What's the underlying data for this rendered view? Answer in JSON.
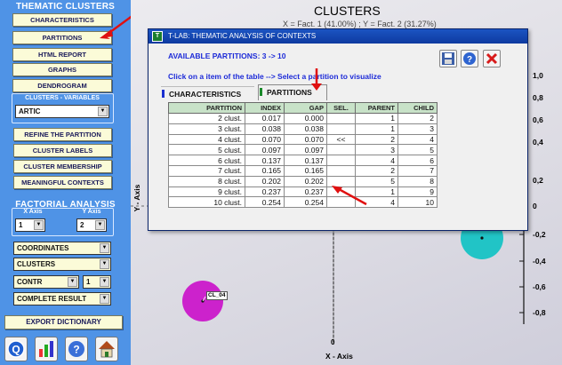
{
  "left_panel": {
    "thematic_clusters_title": "THEMATIC CLUSTERS",
    "buttons": [
      "CHARACTERISTICS",
      "PARTITIONS",
      "HTML REPORT",
      "GRAPHS",
      "DENDROGRAM"
    ],
    "clusters_variables_title": "CLUSTERS - VARIABLES",
    "variable_select": "ARTIC",
    "buttons2": [
      "REFINE THE PARTITION",
      "CLUSTER LABELS",
      "CLUSTER MEMBERSHIP",
      "MEANINGFUL CONTEXTS"
    ],
    "factorial_title": "FACTORIAL ANALYSIS",
    "x_axis_label": "X Axis",
    "y_axis_label": "Y Axis",
    "x_axis_value": "1",
    "y_axis_value": "2",
    "coordinates_select": "COORDINATES",
    "clusters_select": "CLUSTERS",
    "contr_select": "CONTR",
    "contr_num_select": "1",
    "complete_result_select": "COMPLETE RESULT",
    "export_button": "EXPORT DICTIONARY",
    "bottom_icons": [
      "q-logo-icon",
      "chart-icon",
      "help-icon",
      "home-icon"
    ]
  },
  "plot": {
    "title": "CLUSTERS",
    "subtitle": "X = Fact. 1 (41.00%) ; Y = Fact. 2 (31.27%)",
    "x_axis_title": "X - Axis",
    "y_axis_title": "Y - Axis",
    "y_ticks": [
      "1,0",
      "0,8",
      "0,6",
      "0,4",
      "0,2",
      "0",
      "-0,2",
      "-0,4",
      "-0,6",
      "-0,8"
    ],
    "x_zero_label": "0",
    "cluster_label": "CL_04",
    "cluster_colors": {
      "cl04": "#cc22cc",
      "teal": "#21c4c6"
    }
  },
  "dialog": {
    "title": "T-LAB: THEMATIC ANALYSIS OF CONTEXTS",
    "available": "AVAILABLE PARTITIONS: 3 -> 10",
    "instruction": "Click on a item of the table --> Select a partition to visualize",
    "tabs": [
      "CHARACTERISTICS",
      "PARTITIONS"
    ],
    "icons": [
      "save-icon",
      "help-icon",
      "close-icon"
    ],
    "table": {
      "headers": [
        "PARTITION",
        "INDEX",
        "GAP",
        "SEL.",
        "PARENT",
        "CHILD"
      ],
      "rows": [
        [
          "2 clust.",
          "0.017",
          "0.000",
          "",
          "1",
          "2"
        ],
        [
          "3 clust.",
          "0.038",
          "0.038",
          "",
          "1",
          "3"
        ],
        [
          "4 clust.",
          "0.070",
          "0.070",
          "<<",
          "2",
          "4"
        ],
        [
          "5 clust.",
          "0.097",
          "0.097",
          "",
          "3",
          "5"
        ],
        [
          "6 clust.",
          "0.137",
          "0.137",
          "",
          "4",
          "6"
        ],
        [
          "7 clust.",
          "0.165",
          "0.165",
          "",
          "2",
          "7"
        ],
        [
          "8 clust.",
          "0.202",
          "0.202",
          "",
          "5",
          "8"
        ],
        [
          "9 clust.",
          "0.237",
          "0.237",
          "",
          "1",
          "9"
        ],
        [
          "10 clust.",
          "0.254",
          "0.254",
          "",
          "4",
          "10"
        ]
      ]
    }
  }
}
